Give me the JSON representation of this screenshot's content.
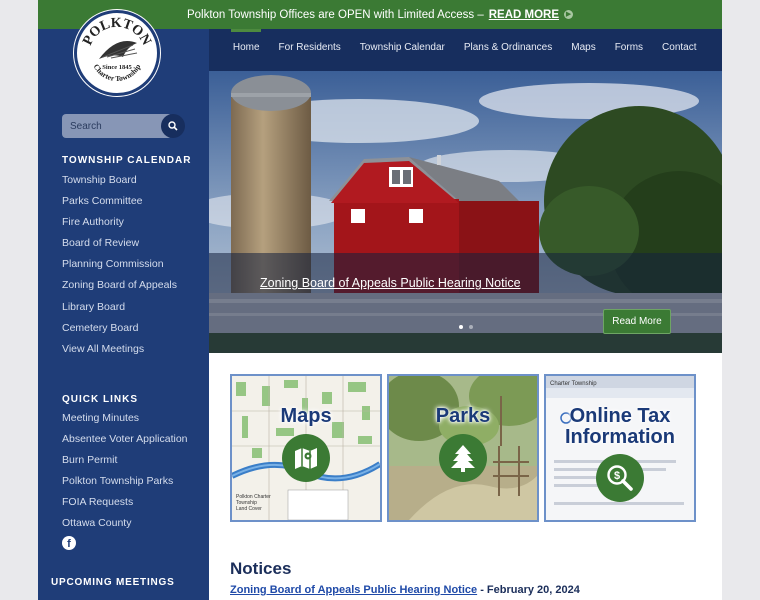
{
  "alert": {
    "text": "Polkton Township Offices are OPEN with Limited Access –",
    "link": "READ MORE"
  },
  "logo": {
    "name": "POLKTON",
    "since": "Since 1845",
    "tagline": "Charter Township"
  },
  "nav": {
    "items": [
      {
        "label": "Home",
        "active": true
      },
      {
        "label": "For Residents"
      },
      {
        "label": "Township Calendar"
      },
      {
        "label": "Plans & Ordinances"
      },
      {
        "label": "Maps"
      },
      {
        "label": "Forms"
      },
      {
        "label": "Contact"
      }
    ]
  },
  "search": {
    "placeholder": "Search"
  },
  "calendar": {
    "heading": "TOWNSHIP CALENDAR",
    "items": [
      "Township Board",
      "Parks Committee",
      "Fire Authority",
      "Board of Review",
      "Planning Commission",
      "Zoning Board of Appeals",
      "Library Board",
      "Cemetery Board",
      "View All Meetings"
    ]
  },
  "quick_links": {
    "heading": "QUICK LINKS",
    "items": [
      "Meeting Minutes",
      "Absentee Voter Application",
      "Burn Permit",
      "Polkton Township Parks",
      "FOIA Requests",
      "Ottawa County"
    ]
  },
  "upcoming": {
    "heading": "UPCOMING MEETINGS"
  },
  "hero": {
    "title": "Zoning Board of Appeals Public Hearing Notice",
    "button": "Read More"
  },
  "tiles": [
    {
      "title": "Maps",
      "icon": "map-icon"
    },
    {
      "title": "Parks",
      "icon": "tree-icon"
    },
    {
      "title": "Online Tax Information",
      "icon": "dollar-search-icon"
    }
  ],
  "map_tile_caption": "Polkton Charter Township Land Cover",
  "tax_tile_header": "Charter Township",
  "notices": {
    "heading": "Notices",
    "items": [
      {
        "title": "Zoning Board of Appeals Public Hearing Notice",
        "date": "- February 20, 2024"
      }
    ]
  },
  "colors": {
    "green": "#3b7a34",
    "sidebar": "#1f3d78",
    "navbar": "#172e5e"
  }
}
